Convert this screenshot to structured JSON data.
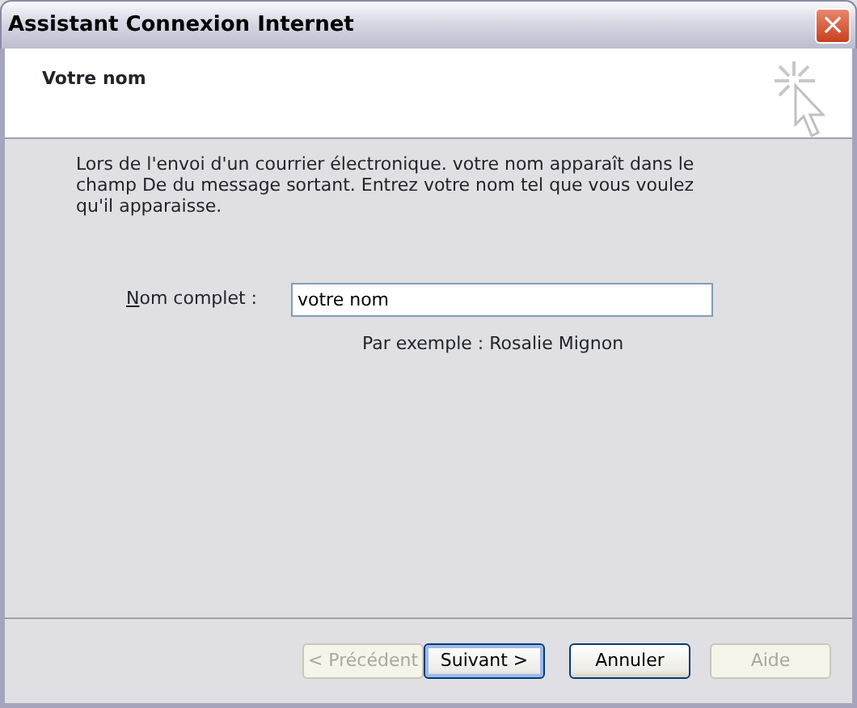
{
  "window": {
    "title": "Assistant Connexion Internet",
    "close": "×"
  },
  "header": {
    "title": "Votre nom"
  },
  "intro": "Lors de l'envoi d'un courrier électronique. votre nom apparaît dans le champ De du message sortant. Entrez votre nom tel que vous voulez qu'il apparaisse.",
  "field": {
    "label": "Nom complet :",
    "value": "votre nom",
    "hint": "Par exemple : Rosalie Mignon"
  },
  "buttons": [
    {
      "label": "< Précédent",
      "disabled": true,
      "default": false
    },
    {
      "label": "Suivant >",
      "disabled": false,
      "default": true
    },
    {
      "label": "Annuler",
      "disabled": false,
      "default": false
    },
    {
      "label": "Aide",
      "disabled": true,
      "default": false
    }
  ]
}
